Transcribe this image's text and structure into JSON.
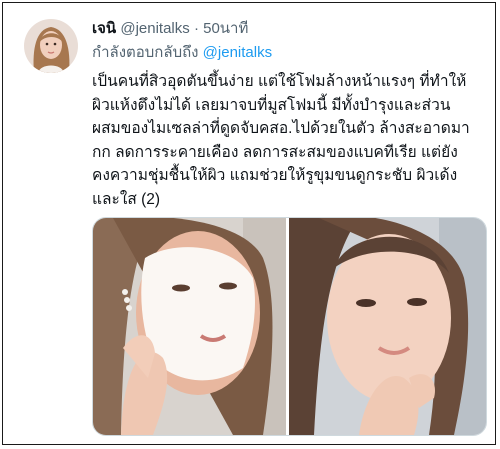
{
  "tweet": {
    "display_name": "เจนิ",
    "handle": "@jenitalks",
    "separator": "·",
    "time_ago": "50นาที",
    "replying_to_label": "กำลังตอบกลับถึง",
    "replying_to_handle": "@jenitalks",
    "text_lines": [
      "เป็นคนที่สิวอุดตันขึ้นง่าย แต่ใช้โฟมล้างหน้าแรงๆ ที่ทำให้",
      "ผิวแห้งตึงไม่ได้ เลยมาจบที่มูสโฟมนี้ มีทั้งบำรุงและส่วน",
      "ผสมของไมเซลล่าที่ดูดจับคสอ.ไปด้วยในตัว ล้างสะอาดมา",
      "กก ลดการระคายเคือง ลดการสะสมของแบคทีเรีย แต่ยัง",
      "คงความชุ่มชื้นให้ผิว แถมช่วยให้รูขุมขนดูกระชับ ผิวเด้ง",
      "และใส (2)"
    ]
  },
  "media": {
    "photos": [
      {
        "name": "photo-foam-wash",
        "icon": "face-with-foam"
      },
      {
        "name": "photo-clean-face",
        "icon": "face-clean"
      }
    ]
  },
  "colors": {
    "text_primary": "#0f1419",
    "text_secondary": "#536471",
    "link": "#1d9bf0",
    "border": "#cfd9de"
  }
}
